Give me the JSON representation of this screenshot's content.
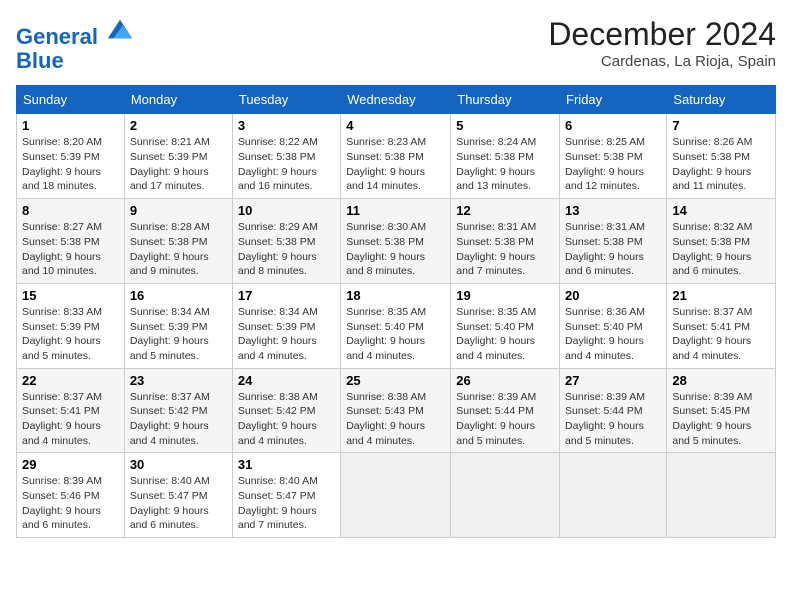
{
  "header": {
    "logo_line1": "General",
    "logo_line2": "Blue",
    "month": "December 2024",
    "location": "Cardenas, La Rioja, Spain"
  },
  "weekdays": [
    "Sunday",
    "Monday",
    "Tuesday",
    "Wednesday",
    "Thursday",
    "Friday",
    "Saturday"
  ],
  "weeks": [
    [
      {
        "day": "1",
        "sunrise": "8:20 AM",
        "sunset": "5:39 PM",
        "daylight": "9 hours and 18 minutes."
      },
      {
        "day": "2",
        "sunrise": "8:21 AM",
        "sunset": "5:39 PM",
        "daylight": "9 hours and 17 minutes."
      },
      {
        "day": "3",
        "sunrise": "8:22 AM",
        "sunset": "5:38 PM",
        "daylight": "9 hours and 16 minutes."
      },
      {
        "day": "4",
        "sunrise": "8:23 AM",
        "sunset": "5:38 PM",
        "daylight": "9 hours and 14 minutes."
      },
      {
        "day": "5",
        "sunrise": "8:24 AM",
        "sunset": "5:38 PM",
        "daylight": "9 hours and 13 minutes."
      },
      {
        "day": "6",
        "sunrise": "8:25 AM",
        "sunset": "5:38 PM",
        "daylight": "9 hours and 12 minutes."
      },
      {
        "day": "7",
        "sunrise": "8:26 AM",
        "sunset": "5:38 PM",
        "daylight": "9 hours and 11 minutes."
      }
    ],
    [
      {
        "day": "8",
        "sunrise": "8:27 AM",
        "sunset": "5:38 PM",
        "daylight": "9 hours and 10 minutes."
      },
      {
        "day": "9",
        "sunrise": "8:28 AM",
        "sunset": "5:38 PM",
        "daylight": "9 hours and 9 minutes."
      },
      {
        "day": "10",
        "sunrise": "8:29 AM",
        "sunset": "5:38 PM",
        "daylight": "9 hours and 8 minutes."
      },
      {
        "day": "11",
        "sunrise": "8:30 AM",
        "sunset": "5:38 PM",
        "daylight": "9 hours and 8 minutes."
      },
      {
        "day": "12",
        "sunrise": "8:31 AM",
        "sunset": "5:38 PM",
        "daylight": "9 hours and 7 minutes."
      },
      {
        "day": "13",
        "sunrise": "8:31 AM",
        "sunset": "5:38 PM",
        "daylight": "9 hours and 6 minutes."
      },
      {
        "day": "14",
        "sunrise": "8:32 AM",
        "sunset": "5:38 PM",
        "daylight": "9 hours and 6 minutes."
      }
    ],
    [
      {
        "day": "15",
        "sunrise": "8:33 AM",
        "sunset": "5:39 PM",
        "daylight": "9 hours and 5 minutes."
      },
      {
        "day": "16",
        "sunrise": "8:34 AM",
        "sunset": "5:39 PM",
        "daylight": "9 hours and 5 minutes."
      },
      {
        "day": "17",
        "sunrise": "8:34 AM",
        "sunset": "5:39 PM",
        "daylight": "9 hours and 4 minutes."
      },
      {
        "day": "18",
        "sunrise": "8:35 AM",
        "sunset": "5:40 PM",
        "daylight": "9 hours and 4 minutes."
      },
      {
        "day": "19",
        "sunrise": "8:35 AM",
        "sunset": "5:40 PM",
        "daylight": "9 hours and 4 minutes."
      },
      {
        "day": "20",
        "sunrise": "8:36 AM",
        "sunset": "5:40 PM",
        "daylight": "9 hours and 4 minutes."
      },
      {
        "day": "21",
        "sunrise": "8:37 AM",
        "sunset": "5:41 PM",
        "daylight": "9 hours and 4 minutes."
      }
    ],
    [
      {
        "day": "22",
        "sunrise": "8:37 AM",
        "sunset": "5:41 PM",
        "daylight": "9 hours and 4 minutes."
      },
      {
        "day": "23",
        "sunrise": "8:37 AM",
        "sunset": "5:42 PM",
        "daylight": "9 hours and 4 minutes."
      },
      {
        "day": "24",
        "sunrise": "8:38 AM",
        "sunset": "5:42 PM",
        "daylight": "9 hours and 4 minutes."
      },
      {
        "day": "25",
        "sunrise": "8:38 AM",
        "sunset": "5:43 PM",
        "daylight": "9 hours and 4 minutes."
      },
      {
        "day": "26",
        "sunrise": "8:39 AM",
        "sunset": "5:44 PM",
        "daylight": "9 hours and 5 minutes."
      },
      {
        "day": "27",
        "sunrise": "8:39 AM",
        "sunset": "5:44 PM",
        "daylight": "9 hours and 5 minutes."
      },
      {
        "day": "28",
        "sunrise": "8:39 AM",
        "sunset": "5:45 PM",
        "daylight": "9 hours and 5 minutes."
      }
    ],
    [
      {
        "day": "29",
        "sunrise": "8:39 AM",
        "sunset": "5:46 PM",
        "daylight": "9 hours and 6 minutes."
      },
      {
        "day": "30",
        "sunrise": "8:40 AM",
        "sunset": "5:47 PM",
        "daylight": "9 hours and 6 minutes."
      },
      {
        "day": "31",
        "sunrise": "8:40 AM",
        "sunset": "5:47 PM",
        "daylight": "9 hours and 7 minutes."
      },
      null,
      null,
      null,
      null
    ]
  ]
}
